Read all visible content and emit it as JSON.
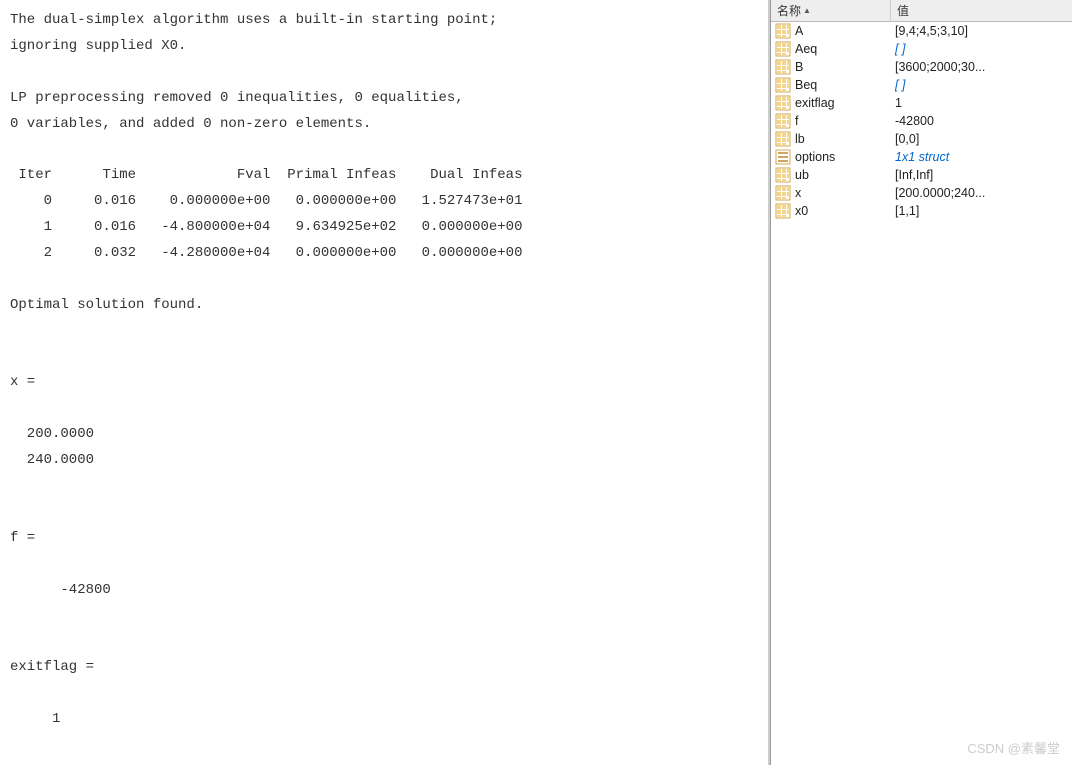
{
  "console": {
    "line1": "The dual-simplex algorithm uses a built-in starting point;",
    "line2": "ignoring supplied X0.",
    "line3": "",
    "line4": "LP preprocessing removed 0 inequalities, 0 equalities,",
    "line5": "0 variables, and added 0 non-zero elements.",
    "line6": "",
    "tableHeader": " Iter      Time            Fval  Primal Infeas    Dual Infeas",
    "tableRow0": "    0     0.016    0.000000e+00   0.000000e+00   1.527473e+01",
    "tableRow1": "    1     0.016   -4.800000e+04   9.634925e+02   0.000000e+00",
    "tableRow2": "    2     0.032   -4.280000e+04   0.000000e+00   0.000000e+00",
    "line7": "",
    "line8": "Optimal solution found.",
    "line9": "",
    "line10": "",
    "xLabel": "x =",
    "line11": "",
    "xVal1": "  200.0000",
    "xVal2": "  240.0000",
    "line12": "",
    "line13": "",
    "fLabel": "f =",
    "line14": "",
    "fVal": "      -42800",
    "line15": "",
    "line16": "",
    "exitLabel": "exitflag =",
    "line17": "",
    "exitVal": "     1"
  },
  "workspace": {
    "header": {
      "name": "名称",
      "value": "值"
    },
    "vars": [
      {
        "name": "A",
        "value": "[9,4;4,5;3,10]",
        "italic": false,
        "iconType": "matrix"
      },
      {
        "name": "Aeq",
        "value": "[ ]",
        "italic": true,
        "iconType": "matrix"
      },
      {
        "name": "B",
        "value": "[3600;2000;30...",
        "italic": false,
        "iconType": "matrix"
      },
      {
        "name": "Beq",
        "value": "[ ]",
        "italic": true,
        "iconType": "matrix"
      },
      {
        "name": "exitflag",
        "value": "1",
        "italic": false,
        "iconType": "matrix"
      },
      {
        "name": "f",
        "value": "-42800",
        "italic": false,
        "iconType": "matrix"
      },
      {
        "name": "lb",
        "value": "[0,0]",
        "italic": false,
        "iconType": "matrix"
      },
      {
        "name": "options",
        "value": "1x1 struct",
        "italic": true,
        "iconType": "struct"
      },
      {
        "name": "ub",
        "value": "[Inf,Inf]",
        "italic": false,
        "iconType": "matrix"
      },
      {
        "name": "x",
        "value": "[200.0000;240...",
        "italic": false,
        "iconType": "matrix"
      },
      {
        "name": "x0",
        "value": "[1,1]",
        "italic": false,
        "iconType": "matrix"
      }
    ]
  },
  "watermark": "CSDN @素馨堂"
}
